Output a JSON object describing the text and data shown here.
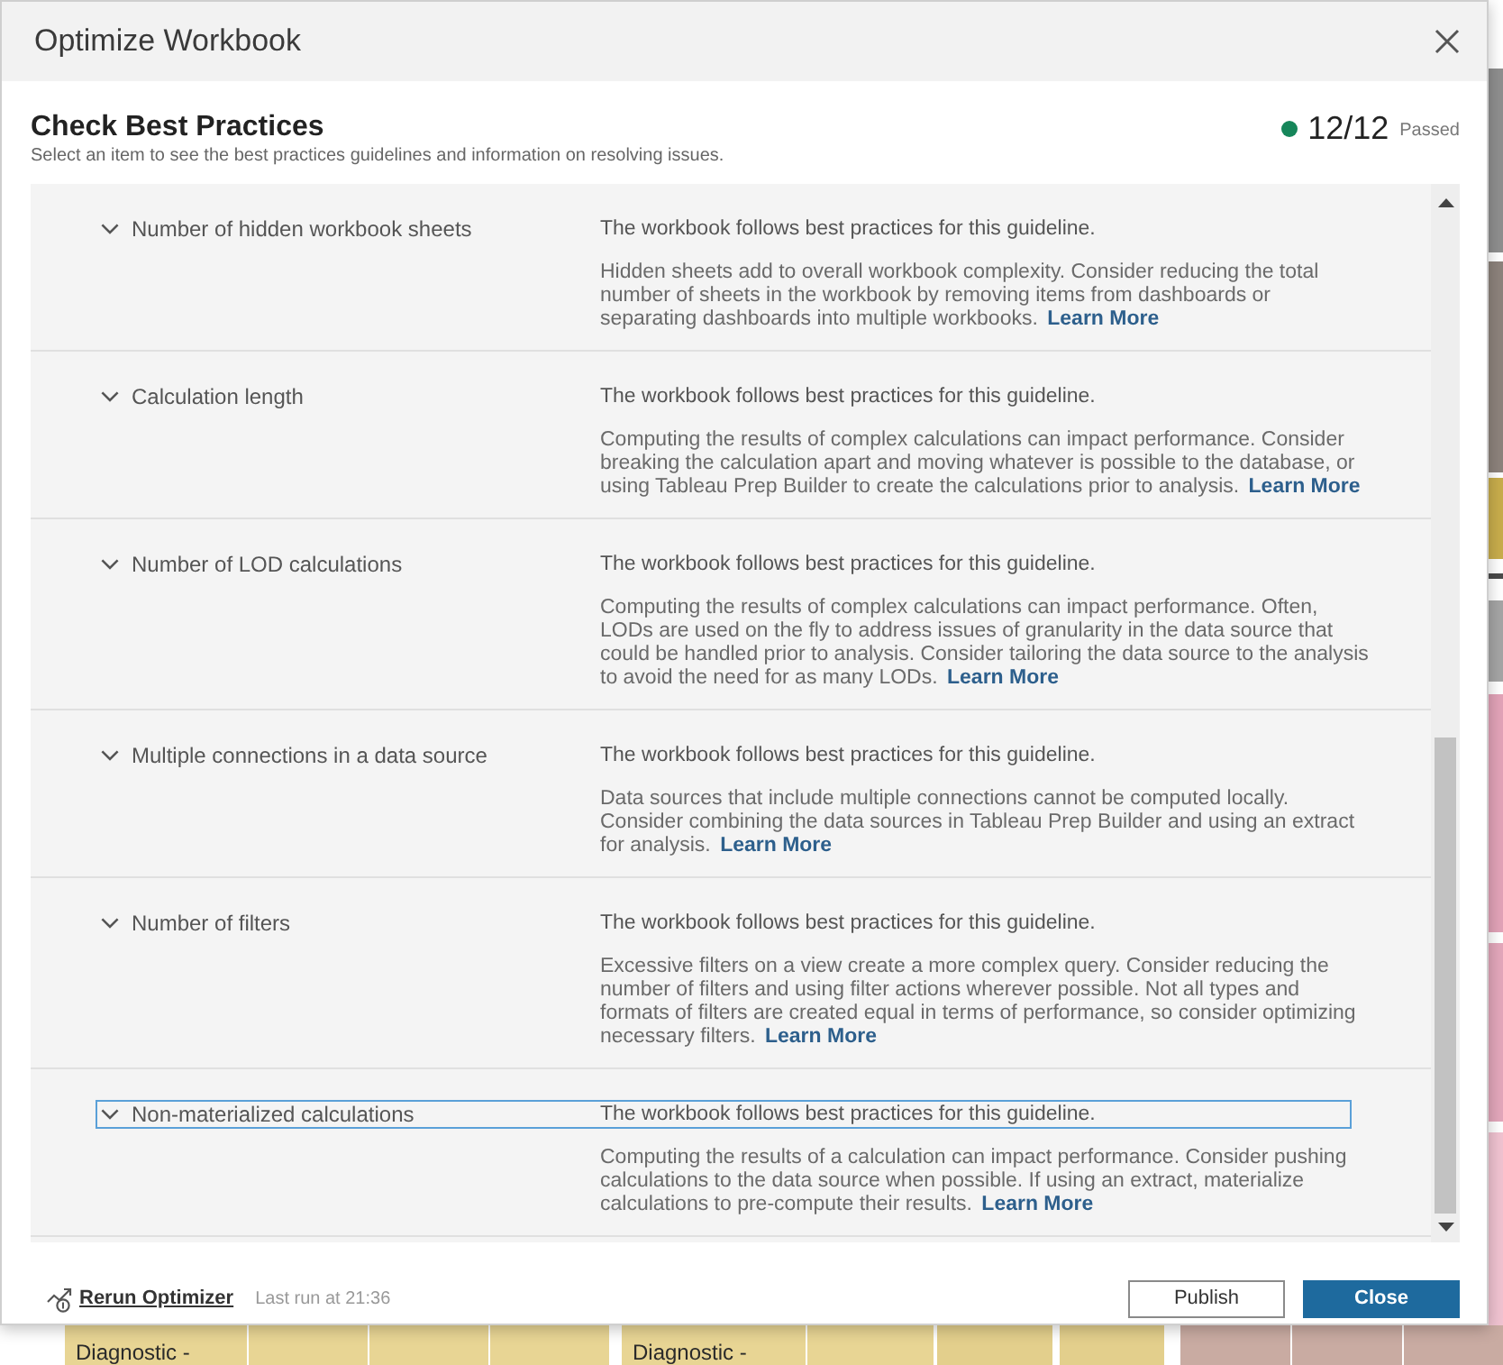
{
  "window": {
    "title": "Optimize Workbook"
  },
  "header": {
    "title": "Check Best Practices",
    "subtitle": "Select an item to see the best practices guidelines and information on resolving issues.",
    "status": {
      "passed": true,
      "count": "12/12",
      "label": "Passed"
    }
  },
  "guidelines": [
    {
      "name": "Number of hidden workbook sheets",
      "expanded": true,
      "selected": false,
      "result": "The workbook follows best practices for this guideline.",
      "details": "Hidden sheets add to overall workbook complexity. Consider reducing the total number of sheets in the workbook by removing items from dashboards or separating dashboards into multiple workbooks.",
      "link": "Learn More"
    },
    {
      "name": "Calculation length",
      "expanded": true,
      "selected": false,
      "result": "The workbook follows best practices for this guideline.",
      "details": "Computing the results of complex calculations can impact performance. Consider breaking the calculation apart and moving whatever is possible to the database, or using Tableau Prep Builder to create the calculations prior to analysis.",
      "link": "Learn More"
    },
    {
      "name": "Number of LOD calculations",
      "expanded": true,
      "selected": false,
      "result": "The workbook follows best practices for this guideline.",
      "details": "Computing the results of complex calculations can impact performance. Often, LODs are used on the fly to address issues of granularity in the data source that could be handled prior to analysis. Consider tailoring the data source to the analysis to avoid the need for as many LODs.",
      "link": "Learn More"
    },
    {
      "name": "Multiple connections in a data source",
      "expanded": true,
      "selected": false,
      "result": "The workbook follows best practices for this guideline.",
      "details": "Data sources that include multiple connections cannot be computed locally. Consider combining the data sources in Tableau Prep Builder and using an extract for analysis.",
      "link": "Learn More"
    },
    {
      "name": "Number of filters",
      "expanded": true,
      "selected": false,
      "result": "The workbook follows best practices for this guideline.",
      "details": "Excessive filters on a view create a more complex query. Consider reducing the number of filters and using filter actions wherever possible. Not all types and formats of filters are created equal in terms of performance, so consider optimizing necessary filters.",
      "link": "Learn More"
    },
    {
      "name": "Non-materialized calculations",
      "expanded": true,
      "selected": true,
      "result": "The workbook follows best practices for this guideline.",
      "details": "Computing the results of a calculation can impact performance. Consider pushing calculations to the data source when possible. If using an extract, materialize calculations to pre-compute their results.",
      "link": "Learn More"
    }
  ],
  "footer": {
    "rerun": "Rerun Optimizer",
    "last_run": "Last run at 21:36",
    "buttons": [
      {
        "label": "Publish",
        "kind": "secondary"
      },
      {
        "label": "Close",
        "kind": "primary"
      }
    ]
  },
  "background": {
    "tile_labels": [
      "Diagnostic -",
      "Diagnostic -"
    ]
  }
}
